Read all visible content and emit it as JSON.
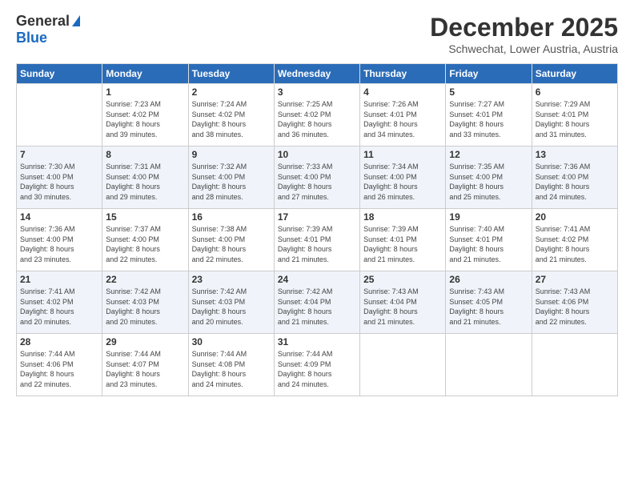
{
  "header": {
    "logo_general": "General",
    "logo_blue": "Blue",
    "month_title": "December 2025",
    "location": "Schwechat, Lower Austria, Austria"
  },
  "days_of_week": [
    "Sunday",
    "Monday",
    "Tuesday",
    "Wednesday",
    "Thursday",
    "Friday",
    "Saturday"
  ],
  "weeks": [
    [
      {
        "day": "",
        "info": ""
      },
      {
        "day": "1",
        "info": "Sunrise: 7:23 AM\nSunset: 4:02 PM\nDaylight: 8 hours\nand 39 minutes."
      },
      {
        "day": "2",
        "info": "Sunrise: 7:24 AM\nSunset: 4:02 PM\nDaylight: 8 hours\nand 38 minutes."
      },
      {
        "day": "3",
        "info": "Sunrise: 7:25 AM\nSunset: 4:02 PM\nDaylight: 8 hours\nand 36 minutes."
      },
      {
        "day": "4",
        "info": "Sunrise: 7:26 AM\nSunset: 4:01 PM\nDaylight: 8 hours\nand 34 minutes."
      },
      {
        "day": "5",
        "info": "Sunrise: 7:27 AM\nSunset: 4:01 PM\nDaylight: 8 hours\nand 33 minutes."
      },
      {
        "day": "6",
        "info": "Sunrise: 7:29 AM\nSunset: 4:01 PM\nDaylight: 8 hours\nand 31 minutes."
      }
    ],
    [
      {
        "day": "7",
        "info": "Sunrise: 7:30 AM\nSunset: 4:00 PM\nDaylight: 8 hours\nand 30 minutes."
      },
      {
        "day": "8",
        "info": "Sunrise: 7:31 AM\nSunset: 4:00 PM\nDaylight: 8 hours\nand 29 minutes."
      },
      {
        "day": "9",
        "info": "Sunrise: 7:32 AM\nSunset: 4:00 PM\nDaylight: 8 hours\nand 28 minutes."
      },
      {
        "day": "10",
        "info": "Sunrise: 7:33 AM\nSunset: 4:00 PM\nDaylight: 8 hours\nand 27 minutes."
      },
      {
        "day": "11",
        "info": "Sunrise: 7:34 AM\nSunset: 4:00 PM\nDaylight: 8 hours\nand 26 minutes."
      },
      {
        "day": "12",
        "info": "Sunrise: 7:35 AM\nSunset: 4:00 PM\nDaylight: 8 hours\nand 25 minutes."
      },
      {
        "day": "13",
        "info": "Sunrise: 7:36 AM\nSunset: 4:00 PM\nDaylight: 8 hours\nand 24 minutes."
      }
    ],
    [
      {
        "day": "14",
        "info": "Sunrise: 7:36 AM\nSunset: 4:00 PM\nDaylight: 8 hours\nand 23 minutes."
      },
      {
        "day": "15",
        "info": "Sunrise: 7:37 AM\nSunset: 4:00 PM\nDaylight: 8 hours\nand 22 minutes."
      },
      {
        "day": "16",
        "info": "Sunrise: 7:38 AM\nSunset: 4:00 PM\nDaylight: 8 hours\nand 22 minutes."
      },
      {
        "day": "17",
        "info": "Sunrise: 7:39 AM\nSunset: 4:01 PM\nDaylight: 8 hours\nand 21 minutes."
      },
      {
        "day": "18",
        "info": "Sunrise: 7:39 AM\nSunset: 4:01 PM\nDaylight: 8 hours\nand 21 minutes."
      },
      {
        "day": "19",
        "info": "Sunrise: 7:40 AM\nSunset: 4:01 PM\nDaylight: 8 hours\nand 21 minutes."
      },
      {
        "day": "20",
        "info": "Sunrise: 7:41 AM\nSunset: 4:02 PM\nDaylight: 8 hours\nand 21 minutes."
      }
    ],
    [
      {
        "day": "21",
        "info": "Sunrise: 7:41 AM\nSunset: 4:02 PM\nDaylight: 8 hours\nand 20 minutes."
      },
      {
        "day": "22",
        "info": "Sunrise: 7:42 AM\nSunset: 4:03 PM\nDaylight: 8 hours\nand 20 minutes."
      },
      {
        "day": "23",
        "info": "Sunrise: 7:42 AM\nSunset: 4:03 PM\nDaylight: 8 hours\nand 20 minutes."
      },
      {
        "day": "24",
        "info": "Sunrise: 7:42 AM\nSunset: 4:04 PM\nDaylight: 8 hours\nand 21 minutes."
      },
      {
        "day": "25",
        "info": "Sunrise: 7:43 AM\nSunset: 4:04 PM\nDaylight: 8 hours\nand 21 minutes."
      },
      {
        "day": "26",
        "info": "Sunrise: 7:43 AM\nSunset: 4:05 PM\nDaylight: 8 hours\nand 21 minutes."
      },
      {
        "day": "27",
        "info": "Sunrise: 7:43 AM\nSunset: 4:06 PM\nDaylight: 8 hours\nand 22 minutes."
      }
    ],
    [
      {
        "day": "28",
        "info": "Sunrise: 7:44 AM\nSunset: 4:06 PM\nDaylight: 8 hours\nand 22 minutes."
      },
      {
        "day": "29",
        "info": "Sunrise: 7:44 AM\nSunset: 4:07 PM\nDaylight: 8 hours\nand 23 minutes."
      },
      {
        "day": "30",
        "info": "Sunrise: 7:44 AM\nSunset: 4:08 PM\nDaylight: 8 hours\nand 24 minutes."
      },
      {
        "day": "31",
        "info": "Sunrise: 7:44 AM\nSunset: 4:09 PM\nDaylight: 8 hours\nand 24 minutes."
      },
      {
        "day": "",
        "info": ""
      },
      {
        "day": "",
        "info": ""
      },
      {
        "day": "",
        "info": ""
      }
    ]
  ]
}
